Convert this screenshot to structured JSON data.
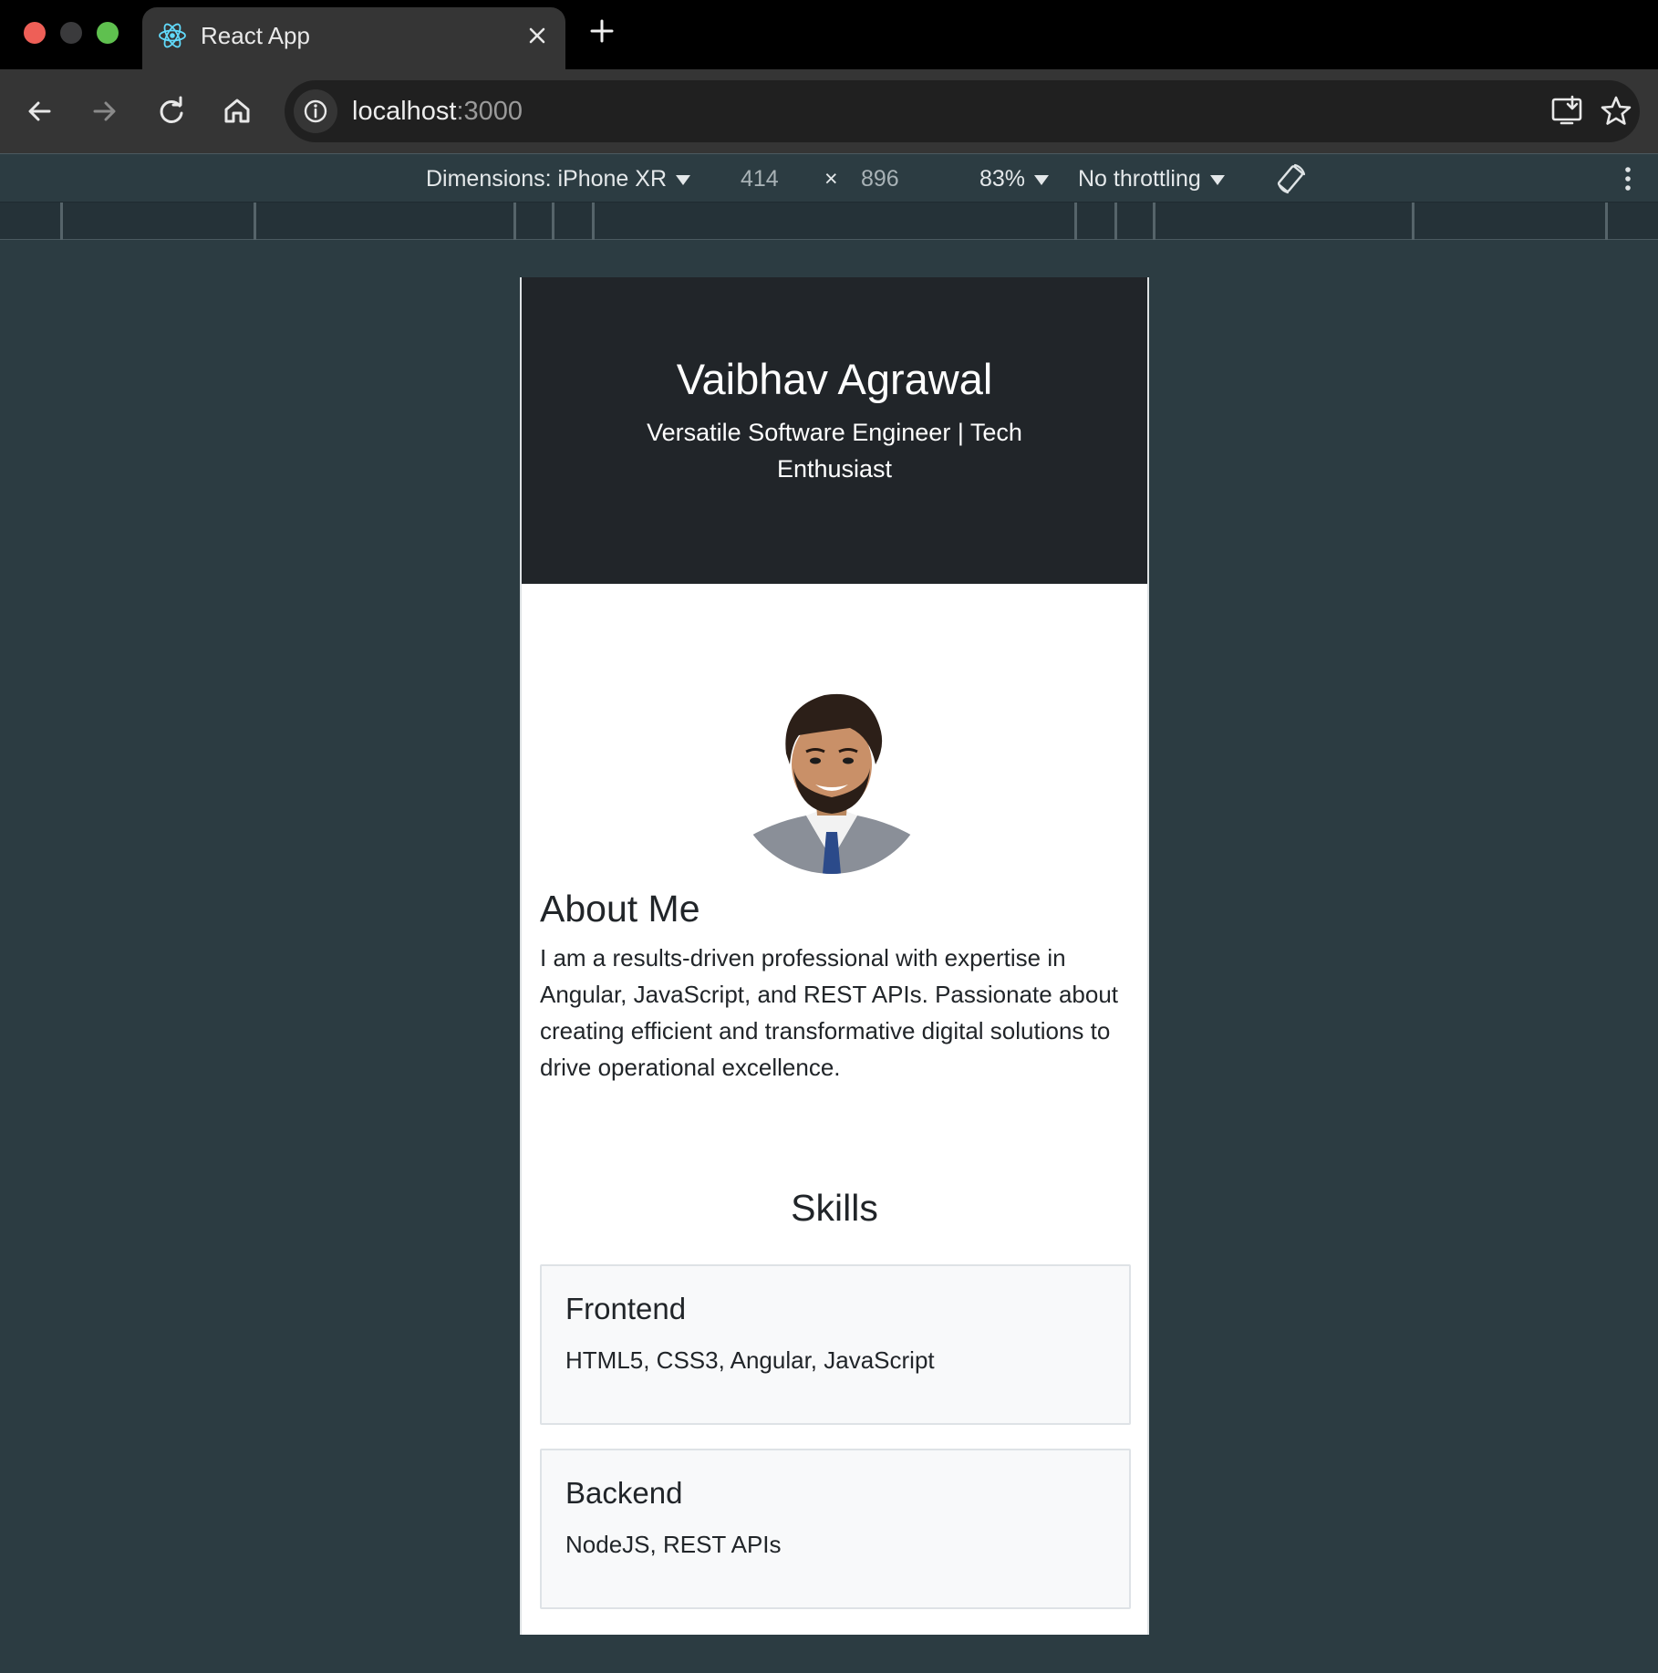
{
  "browser": {
    "tab": {
      "title": "React App"
    },
    "address": {
      "host": "localhost",
      "port": ":3000"
    }
  },
  "device_toolbar": {
    "dimensions_label": "Dimensions: iPhone XR",
    "width": "414",
    "times": "×",
    "height": "896",
    "zoom": "83%",
    "throttling": "No throttling"
  },
  "page": {
    "hero": {
      "name": "Vaibhav Agrawal",
      "tagline": "Versatile Software Engineer | Tech Enthusiast"
    },
    "about": {
      "heading": "About Me",
      "text": "I am a results-driven professional with expertise in Angular, JavaScript, and REST APIs. Passionate about creating efficient and transformative digital solutions to drive operational excellence."
    },
    "skills": {
      "heading": "Skills",
      "cards": [
        {
          "title": "Frontend",
          "list": "HTML5, CSS3, Angular, JavaScript"
        },
        {
          "title": "Backend",
          "list": "NodeJS, REST APIs"
        }
      ]
    }
  },
  "icons": {
    "favicon": "react-atom-icon",
    "close": "close-icon",
    "new_tab": "plus-icon",
    "back": "arrow-left-icon",
    "forward": "arrow-right-icon",
    "reload": "reload-icon",
    "home": "home-icon",
    "site_info": "info-icon",
    "install": "install-icon",
    "bookmark": "star-icon",
    "rotate": "rotate-icon",
    "more": "more-vertical-icon"
  },
  "colors": {
    "hero_bg": "#212529",
    "page_bg": "#2c3c42",
    "card_bg": "#f8f9fa",
    "accent_react": "#61dafb"
  }
}
